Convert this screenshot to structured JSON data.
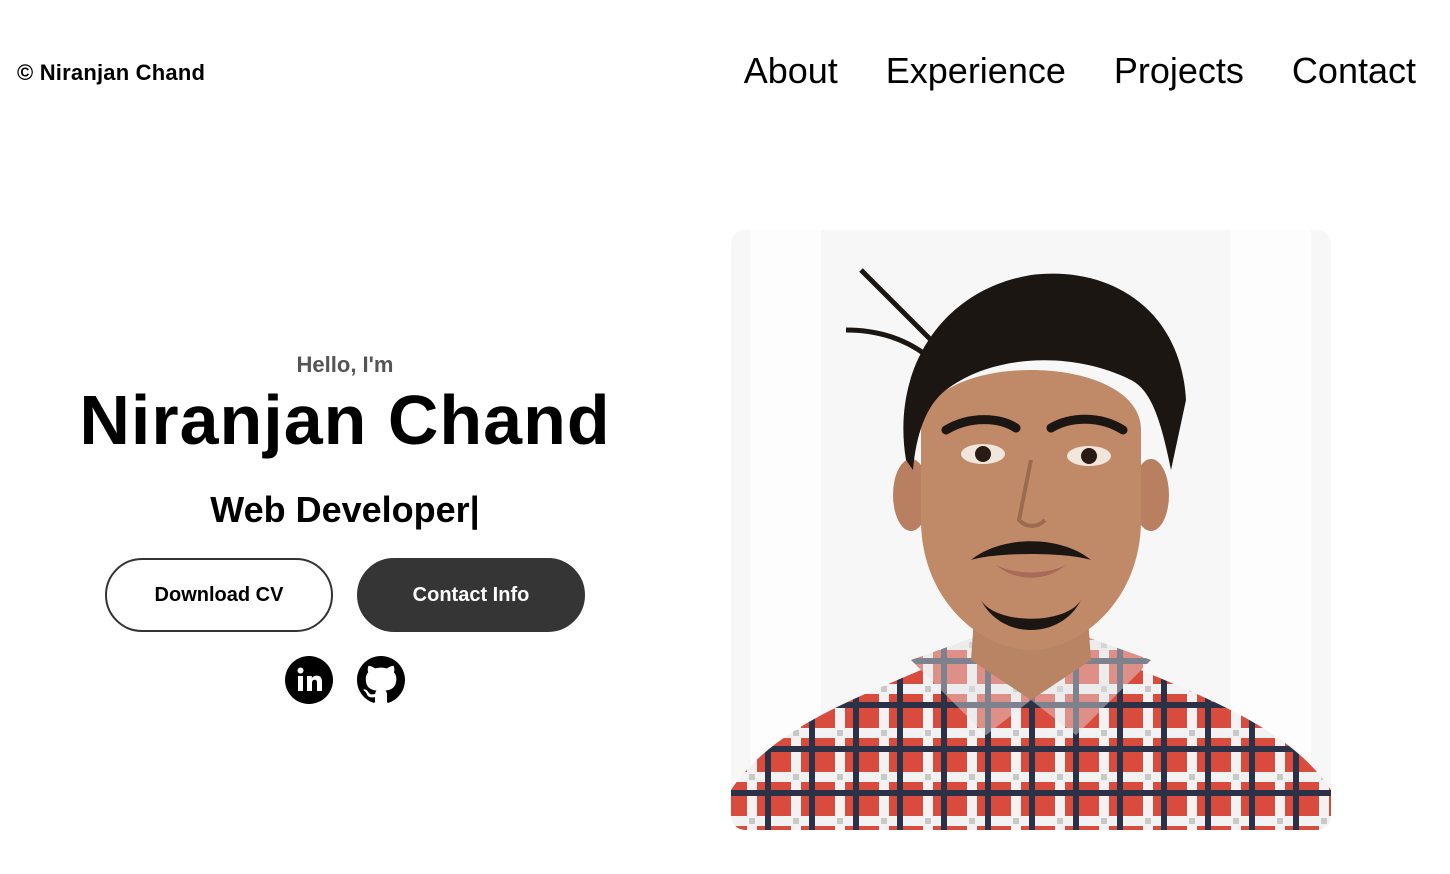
{
  "header": {
    "logo": "© Niranjan Chand",
    "nav": [
      "About",
      "Experience",
      "Projects",
      "Contact"
    ]
  },
  "hero": {
    "greeting": "Hello, I'm",
    "name": "Niranjan Chand",
    "role": "Web Developer|",
    "buttons": {
      "download_cv": "Download CV",
      "contact_info": "Contact Info"
    },
    "socials": [
      "linkedin-icon",
      "github-icon"
    ]
  },
  "colors": {
    "text": "#000000",
    "muted": "#555555",
    "button_dark": "#353535"
  }
}
